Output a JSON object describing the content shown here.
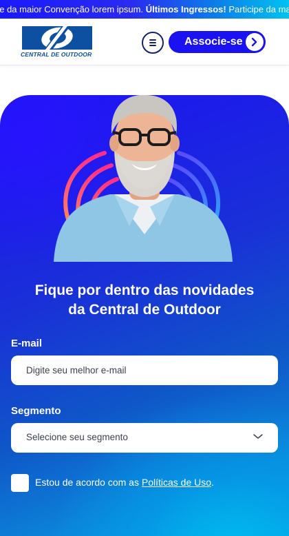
{
  "ticker": {
    "part1": "pe da maior Convenção lorem ipsum.",
    "highlight": "Últimos Ingressos!",
    "part2": "Participe da maior"
  },
  "header": {
    "logo_text": "CENTRAL DE OUTDOOR",
    "menu_icon": "hamburger-icon",
    "cta_label": "Associe-se",
    "cta_icon": "chevron-right-icon"
  },
  "hero": {
    "headline_line1": "Fique por dentro das novidades",
    "headline_line2": "da Central de Outdoor"
  },
  "form": {
    "email_label": "E-mail",
    "email_placeholder": "Digite seu melhor e-mail",
    "email_value": "",
    "segment_label": "Segmento",
    "segment_selected": "Selecione seu segmento",
    "segment_icon": "chevron-down-icon",
    "consent_text": "Estou de acordo com as ",
    "consent_link": "Políticas de Uso",
    "consent_end": "."
  },
  "colors": {
    "brand_blue": "#1b12f2",
    "logo_blue": "#0d4fa0",
    "navy": "#10246b",
    "cyan": "#00c2f0"
  }
}
